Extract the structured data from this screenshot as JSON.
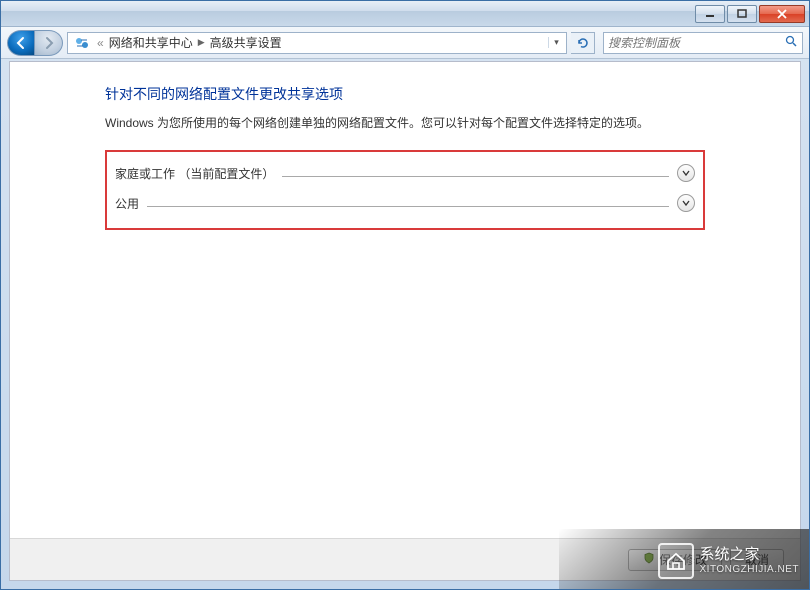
{
  "window": {
    "minimize_tooltip": "最小化",
    "maximize_tooltip": "最大化",
    "close_tooltip": "关闭"
  },
  "nav": {
    "back_tooltip": "返回",
    "forward_tooltip": "前进"
  },
  "breadcrumb": {
    "prefix": "«",
    "segments": [
      "网络和共享中心",
      "高级共享设置"
    ]
  },
  "search": {
    "placeholder": "搜索控制面板"
  },
  "page": {
    "title": "针对不同的网络配置文件更改共享选项",
    "description": "Windows 为您所使用的每个网络创建单独的网络配置文件。您可以针对每个配置文件选择特定的选项。"
  },
  "profiles": [
    {
      "label": "家庭或工作 （当前配置文件）"
    },
    {
      "label": "公用"
    }
  ],
  "buttons": {
    "save_icon": "✔",
    "save": "保存修改",
    "cancel": "取消"
  },
  "watermark": {
    "brand": "系统之家",
    "sub": "XITONGZHIJIA.NET"
  }
}
